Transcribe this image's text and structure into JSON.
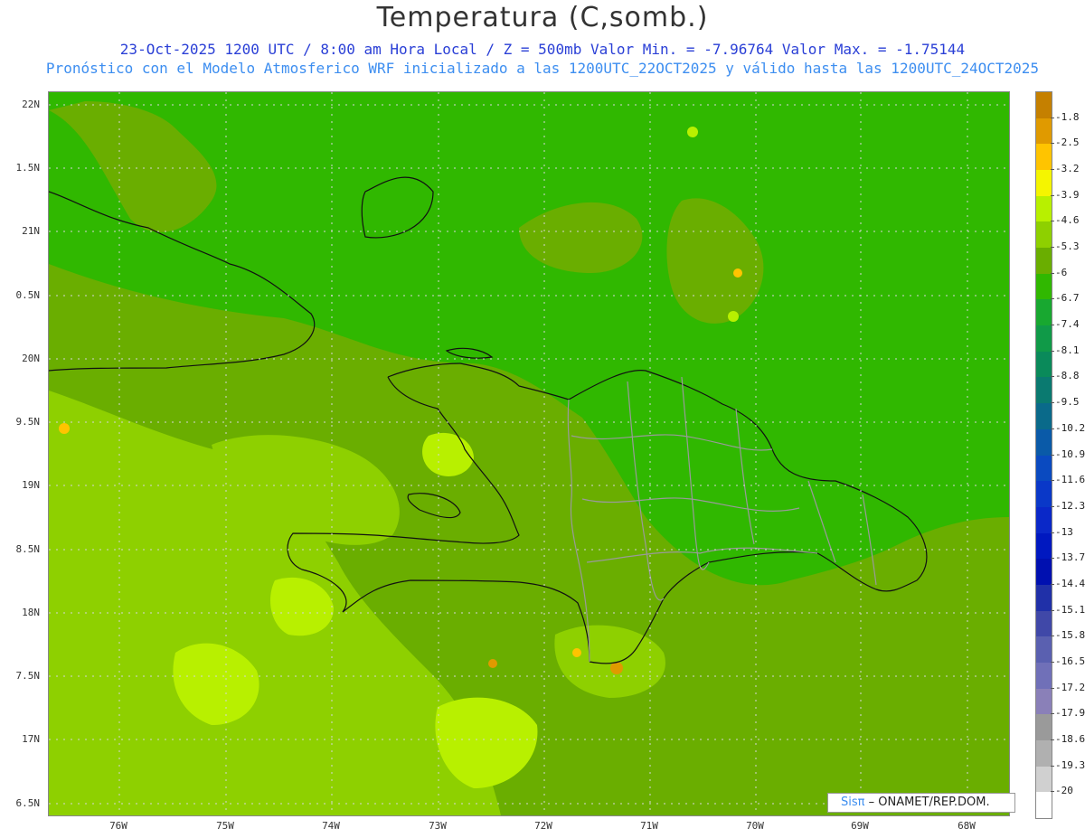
{
  "header": {
    "title": "Temperatura (C,somb.)",
    "subtitle1": "23-Oct-2025  1200 UTC / 8:00 am Hora Local / Z = 500mb  Valor Min. = -7.96764  Valor Max. = -1.75144",
    "subtitle2": "Pronóstico con el Modelo Atmosferico WRF inicializado a las 1200UTC_22OCT2025 y válido hasta las  1200UTC_24OCT2025"
  },
  "axes": {
    "lat_labels": [
      "22N",
      "1.5N",
      "21N",
      "0.5N",
      "20N",
      "9.5N",
      "19N",
      "8.5N",
      "18N",
      "7.5N",
      "17N",
      "6.5N"
    ],
    "lon_labels": [
      "76W",
      "75W",
      "74W",
      "73W",
      "72W",
      "71W",
      "70W",
      "69W",
      "68W"
    ]
  },
  "colorbar": {
    "levels": [
      "-1.8",
      "-2.5",
      "-3.2",
      "-3.9",
      "-4.6",
      "-5.3",
      "-6",
      "-6.7",
      "-7.4",
      "-8.1",
      "-8.8",
      "-9.5",
      "-10.2",
      "-10.9",
      "-11.6",
      "-12.3",
      "-13",
      "-13.7",
      "-14.4",
      "-15.1",
      "-15.8",
      "-16.5",
      "-17.2",
      "-17.9",
      "-18.6",
      "-19.3",
      "-20"
    ],
    "colors": [
      "#c58000",
      "#e09a00",
      "#ffc400",
      "#f5f500",
      "#b8f000",
      "#8ed000",
      "#6aae00",
      "#30b800",
      "#18a830",
      "#109a48",
      "#0a8a5a",
      "#0a7a70",
      "#0a6a8a",
      "#0a5aa8",
      "#0a4ac0",
      "#0a38c8",
      "#0a28c8",
      "#0018c0",
      "#0010b0",
      "#2030a8",
      "#4048a8",
      "#5a60b0",
      "#7070b8",
      "#8a80b8",
      "#9a9a9a",
      "#b0b0b0",
      "#d0d0d0",
      "#ffffff"
    ]
  },
  "logo": {
    "brand": "Sisπ",
    "text": " – ONAMET/REP.DOM."
  }
}
